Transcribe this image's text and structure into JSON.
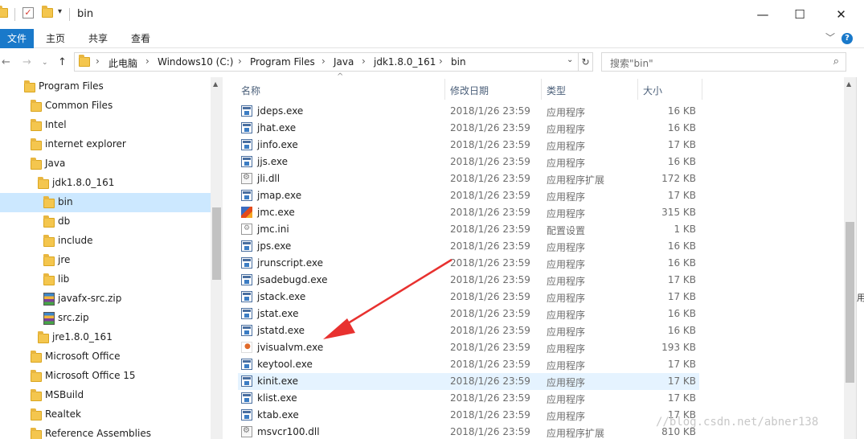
{
  "window": {
    "title": "bin",
    "controls": {
      "minimize": "—",
      "maximize": "☐",
      "close": "✕"
    }
  },
  "ribbon": {
    "tabs": [
      "文件",
      "主页",
      "共享",
      "查看"
    ],
    "help": "?"
  },
  "address": {
    "crumbs": [
      "此电脑",
      "Windows10 (C:)",
      "Program Files",
      "Java",
      "jdk1.8.0_161",
      "bin"
    ],
    "search_placeholder": "搜索\"bin\""
  },
  "nav_tree": [
    {
      "label": "Program Files",
      "type": "folder",
      "level": 0
    },
    {
      "label": "Common Files",
      "type": "folder",
      "level": 1
    },
    {
      "label": "Intel",
      "type": "folder",
      "level": 1
    },
    {
      "label": "internet explorer",
      "type": "folder",
      "level": 1
    },
    {
      "label": "Java",
      "type": "folder",
      "level": 1
    },
    {
      "label": "jdk1.8.0_161",
      "type": "folder",
      "level": 2
    },
    {
      "label": "bin",
      "type": "folder",
      "level": 3,
      "selected": true
    },
    {
      "label": "db",
      "type": "folder",
      "level": 3
    },
    {
      "label": "include",
      "type": "folder",
      "level": 3
    },
    {
      "label": "jre",
      "type": "folder",
      "level": 3
    },
    {
      "label": "lib",
      "type": "folder",
      "level": 3
    },
    {
      "label": "javafx-src.zip",
      "type": "zip",
      "level": 3
    },
    {
      "label": "src.zip",
      "type": "zip",
      "level": 3
    },
    {
      "label": "jre1.8.0_161",
      "type": "folder",
      "level": 2
    },
    {
      "label": "Microsoft Office",
      "type": "folder",
      "level": 1
    },
    {
      "label": "Microsoft Office 15",
      "type": "folder",
      "level": 1
    },
    {
      "label": "MSBuild",
      "type": "folder",
      "level": 1
    },
    {
      "label": "Realtek",
      "type": "folder",
      "level": 1
    },
    {
      "label": "Reference Assemblies",
      "type": "folder",
      "level": 1
    }
  ],
  "columns": {
    "name": "名称",
    "modified": "修改日期",
    "type": "类型",
    "size": "大小"
  },
  "files": [
    {
      "name": "jdeps.exe",
      "date": "2018/1/26 23:59",
      "type": "应用程序",
      "size": "16 KB",
      "icon": "exe"
    },
    {
      "name": "jhat.exe",
      "date": "2018/1/26 23:59",
      "type": "应用程序",
      "size": "16 KB",
      "icon": "exe"
    },
    {
      "name": "jinfo.exe",
      "date": "2018/1/26 23:59",
      "type": "应用程序",
      "size": "17 KB",
      "icon": "exe"
    },
    {
      "name": "jjs.exe",
      "date": "2018/1/26 23:59",
      "type": "应用程序",
      "size": "16 KB",
      "icon": "exe"
    },
    {
      "name": "jli.dll",
      "date": "2018/1/26 23:59",
      "type": "应用程序扩展",
      "size": "172 KB",
      "icon": "dll"
    },
    {
      "name": "jmap.exe",
      "date": "2018/1/26 23:59",
      "type": "应用程序",
      "size": "17 KB",
      "icon": "exe"
    },
    {
      "name": "jmc.exe",
      "date": "2018/1/26 23:59",
      "type": "应用程序",
      "size": "315 KB",
      "icon": "jmc"
    },
    {
      "name": "jmc.ini",
      "date": "2018/1/26 23:59",
      "type": "配置设置",
      "size": "1 KB",
      "icon": "ini"
    },
    {
      "name": "jps.exe",
      "date": "2018/1/26 23:59",
      "type": "应用程序",
      "size": "16 KB",
      "icon": "exe"
    },
    {
      "name": "jrunscript.exe",
      "date": "2018/1/26 23:59",
      "type": "应用程序",
      "size": "16 KB",
      "icon": "exe"
    },
    {
      "name": "jsadebugd.exe",
      "date": "2018/1/26 23:59",
      "type": "应用程序",
      "size": "17 KB",
      "icon": "exe"
    },
    {
      "name": "jstack.exe",
      "date": "2018/1/26 23:59",
      "type": "应用程序",
      "size": "17 KB",
      "icon": "exe"
    },
    {
      "name": "jstat.exe",
      "date": "2018/1/26 23:59",
      "type": "应用程序",
      "size": "16 KB",
      "icon": "exe"
    },
    {
      "name": "jstatd.exe",
      "date": "2018/1/26 23:59",
      "type": "应用程序",
      "size": "16 KB",
      "icon": "exe"
    },
    {
      "name": "jvisualvm.exe",
      "date": "2018/1/26 23:59",
      "type": "应用程序",
      "size": "193 KB",
      "icon": "jvis"
    },
    {
      "name": "keytool.exe",
      "date": "2018/1/26 23:59",
      "type": "应用程序",
      "size": "17 KB",
      "icon": "exe"
    },
    {
      "name": "kinit.exe",
      "date": "2018/1/26 23:59",
      "type": "应用程序",
      "size": "17 KB",
      "icon": "exe",
      "hover": true
    },
    {
      "name": "klist.exe",
      "date": "2018/1/26 23:59",
      "type": "应用程序",
      "size": "17 KB",
      "icon": "exe"
    },
    {
      "name": "ktab.exe",
      "date": "2018/1/26 23:59",
      "type": "应用程序",
      "size": "17 KB",
      "icon": "exe"
    },
    {
      "name": "msvcr100.dll",
      "date": "2018/1/26 23:59",
      "type": "应用程序扩展",
      "size": "810 KB",
      "icon": "dll"
    }
  ],
  "watermark": "//blog.csdn.net/abner138",
  "side_text": "用",
  "annotation_color": "#e8312f"
}
